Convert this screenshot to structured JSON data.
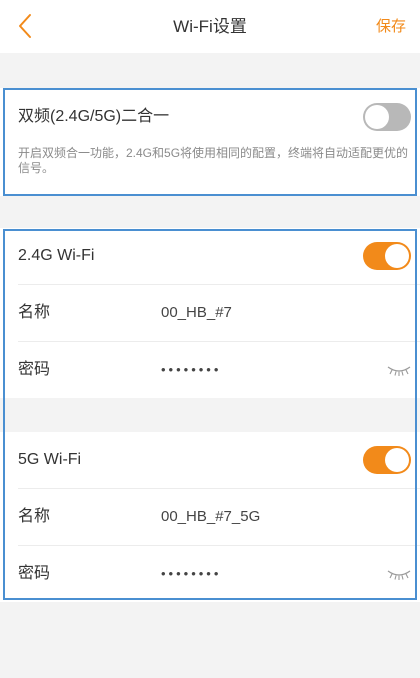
{
  "nav": {
    "title": "Wi-Fi设置",
    "save_label": "保存"
  },
  "dual_band": {
    "title": "双频(2.4G/5G)二合一",
    "description": "开启双频合一功能，2.4G和5G将使用相同的配置，终端将自动适配更优的信号。",
    "enabled": false
  },
  "wifi_24": {
    "title": "2.4G Wi-Fi",
    "enabled": true,
    "name_label": "名称",
    "name_value": "00_HB_#7",
    "password_label": "密码",
    "password_value": "••••••••"
  },
  "wifi_5": {
    "title": "5G Wi-Fi",
    "enabled": true,
    "name_label": "名称",
    "name_value": "00_HB_#7_5G",
    "password_label": "密码",
    "password_value": "••••••••"
  },
  "colors": {
    "accent": "#f28a1a",
    "highlight": "#4a8fd1",
    "toggle_off": "#b8b8b8"
  }
}
